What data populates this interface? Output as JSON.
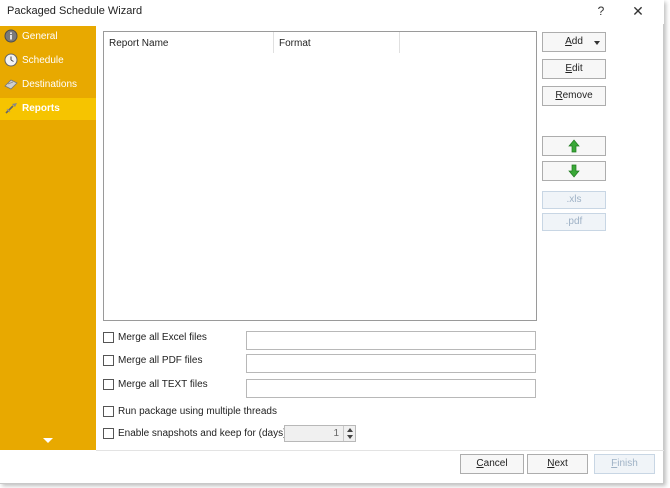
{
  "window": {
    "title": "Packaged Schedule Wizard",
    "help_label": "?",
    "close_label": "✕"
  },
  "colors": {
    "sidebar": "#e8a900",
    "sidebar_active": "#f6c400",
    "arrow_green": "#3aa838"
  },
  "sidebar": {
    "items": [
      {
        "label": "General",
        "icon": "info-icon",
        "active": false
      },
      {
        "label": "Schedule",
        "icon": "clock-icon",
        "active": false
      },
      {
        "label": "Destinations",
        "icon": "destinations-icon",
        "active": false
      },
      {
        "label": "Reports",
        "icon": "reports-icon",
        "active": true
      }
    ],
    "more_icon": "chevron-down-icon"
  },
  "reports_list": {
    "columns": [
      "Report Name",
      "Format"
    ],
    "rows": []
  },
  "buttons": {
    "add": {
      "prefix": "",
      "mnemonic": "A",
      "rest": "dd"
    },
    "edit": {
      "prefix": "",
      "mnemonic": "E",
      "rest": "dit"
    },
    "remove": {
      "prefix": "",
      "mnemonic": "R",
      "rest": "emove"
    },
    "move_up_icon": "arrow-up-icon",
    "move_down_icon": "arrow-down-icon",
    "xls": ".xls",
    "pdf": ".pdf"
  },
  "options": {
    "merge_excel": {
      "label": "Merge all Excel files",
      "checked": false,
      "value": ""
    },
    "merge_pdf": {
      "label": "Merge all PDF files",
      "checked": false,
      "value": ""
    },
    "merge_text": {
      "label": "Merge all TEXT files",
      "checked": false,
      "value": ""
    },
    "multi_threads": {
      "label": "Run package using multiple threads",
      "checked": false
    },
    "snapshots": {
      "label": "Enable snapshots and keep for (days)",
      "checked": false,
      "days": "1"
    }
  },
  "footer": {
    "cancel": {
      "prefix": "",
      "mnemonic": "C",
      "rest": "ancel"
    },
    "next": {
      "prefix": "",
      "mnemonic": "N",
      "rest": "ext"
    },
    "finish": {
      "prefix": "",
      "mnemonic": "F",
      "rest": "inish"
    }
  }
}
